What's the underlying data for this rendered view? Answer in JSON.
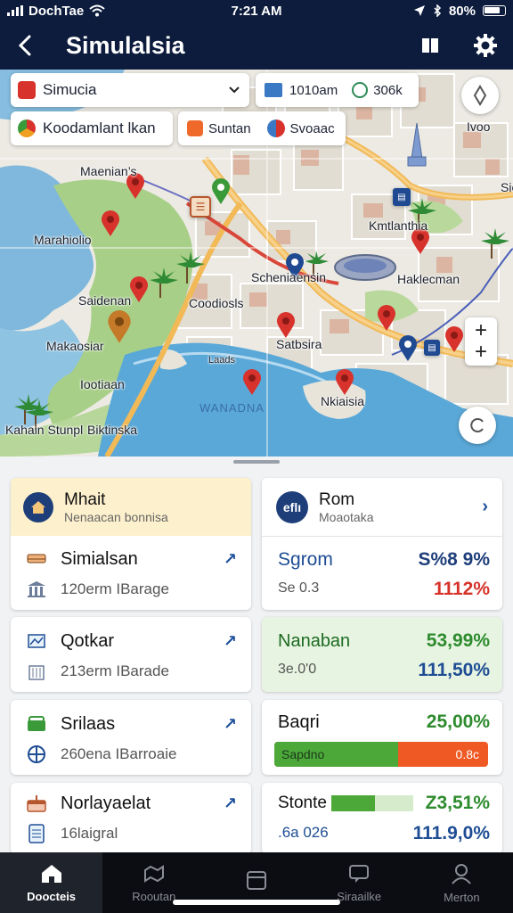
{
  "status": {
    "carrier": "DochTae",
    "time": "7:21 AM",
    "battery": "80%"
  },
  "header": {
    "title": "Simulalsia"
  },
  "map": {
    "pills": {
      "dropdown": "Simucia",
      "distance": "1010am",
      "time": "306k",
      "layer": "Koodamlant lkan",
      "chip_a": "Suntan",
      "chip_b": "Svoaac",
      "compass_label": "Ivoo"
    },
    "labels": {
      "l1": "Maenian’s",
      "l2": "Marahiolio",
      "l3": "Saidenan",
      "l4": "Makaosiar",
      "l5": "Iootiaan",
      "l6": "Kahain Stunpl",
      "l7": "Biktinska",
      "l8": "Scheniaensin",
      "l9": "Coodiosls",
      "l10": "Kmtlanthia",
      "l11": "Haklecman",
      "l12": "Satbsira",
      "l13": "Nkiaisia",
      "l14": "Laads",
      "l15": "WANADNA",
      "l16": "Sie"
    }
  },
  "cards": {
    "left": {
      "header": {
        "title": "Mhait",
        "subtitle": "Nenaacan bonnisa"
      },
      "items": [
        {
          "title": "Simialsan",
          "subtitle": "120erm IBarage"
        },
        {
          "title": "Qotkar",
          "subtitle": "213erm IBarade"
        },
        {
          "title": "Srilaas",
          "subtitle": "260ena IBarroaie"
        },
        {
          "title": "Norlayaelat",
          "subtitle": "16laigral"
        }
      ]
    },
    "right": {
      "header": {
        "icon_text": "eflı",
        "title": "Rom",
        "subtitle": "Moaotaka"
      },
      "stat1": {
        "label": "Sgrom",
        "value": "S%8 9%",
        "sub_label": "Se 0.3",
        "sub_value": "1112%"
      },
      "stat2": {
        "label": "Nanaban",
        "value": "53,99%",
        "sub_label": "3e.0'0",
        "sub_value": "111,50%"
      },
      "stat3": {
        "label": "Baqri",
        "value": "25,00%",
        "bar_label": "Sapdno",
        "bar_value": "0.8c",
        "bar_fraction": 0.58
      },
      "stat4": {
        "label": "Stonte",
        "value": "Z3,51%",
        "bar_fraction": 0.53,
        "sub_label": ".6a 026",
        "sub_value": "111.9,0%"
      }
    }
  },
  "nav": {
    "items": [
      {
        "label": "Doocteis"
      },
      {
        "label": "Rooutan"
      },
      {
        "label": ""
      },
      {
        "label": "Siraailke"
      },
      {
        "label": "Merton"
      }
    ]
  },
  "colors": {
    "navy": "#0d1c3d",
    "green": "#2e8b2e",
    "red": "#d63a22",
    "blue": "#1e4d94",
    "orange": "#ef5a24"
  }
}
